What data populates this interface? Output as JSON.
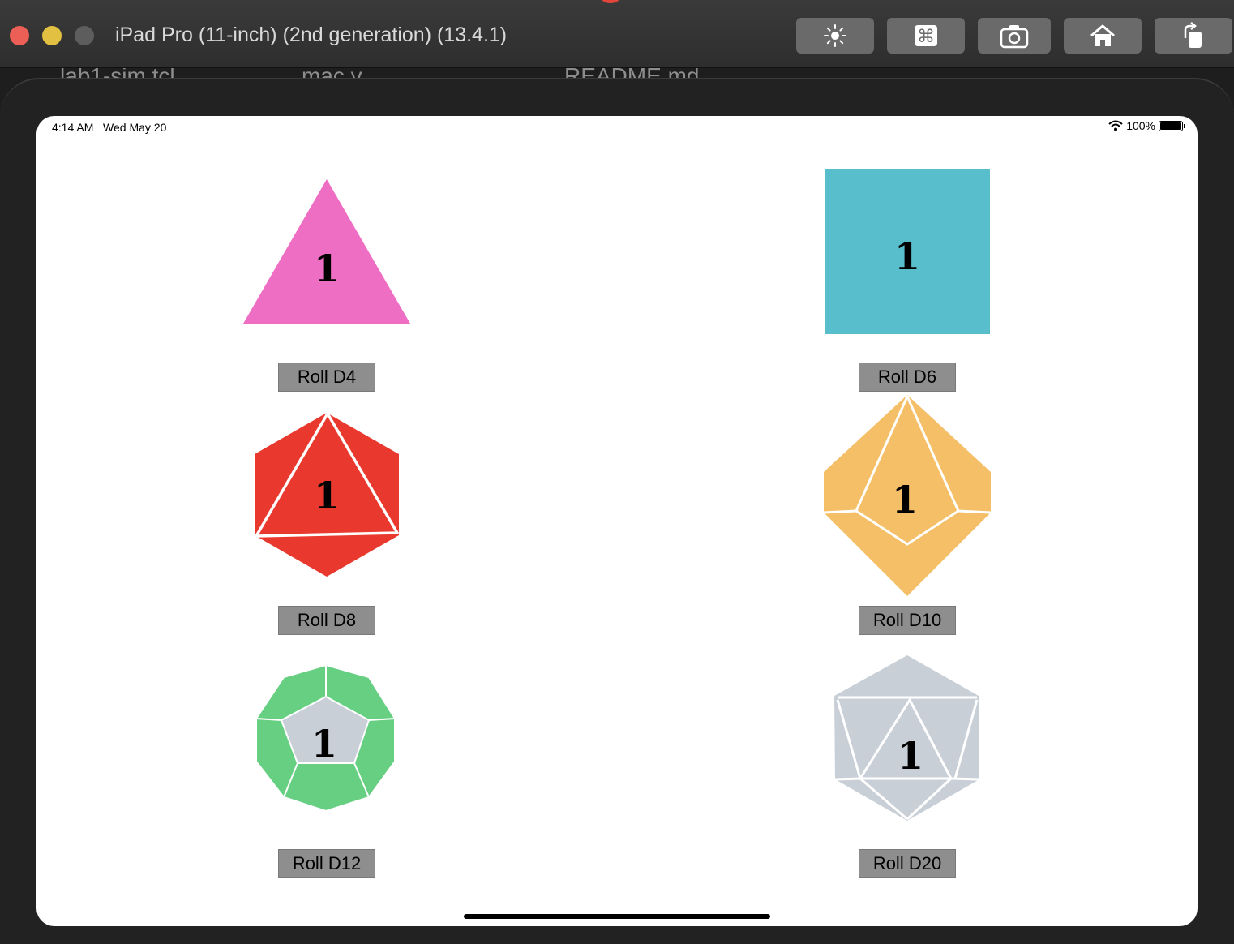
{
  "window": {
    "title": "iPad Pro (11-inch) (2nd generation) (13.4.1)",
    "toolbar": [
      {
        "icon": "brightness-icon"
      },
      {
        "icon": "command-key-icon",
        "label": "⌘"
      },
      {
        "icon": "screenshot-camera-icon"
      },
      {
        "icon": "home-icon"
      },
      {
        "icon": "rotate-icon"
      }
    ]
  },
  "background_editor": {
    "tabs": [
      "lab1-sim.tcl",
      "mac.v",
      "README.md"
    ]
  },
  "status_bar": {
    "time": "4:14 AM",
    "date": "Wed May 20",
    "battery": "100%"
  },
  "dice": [
    {
      "id": "d4",
      "value": "1",
      "color": "#EE6EC4",
      "button": "Roll D4"
    },
    {
      "id": "d6",
      "value": "1",
      "color": "#58BECB",
      "button": "Roll D6"
    },
    {
      "id": "d8",
      "value": "1",
      "color": "#E9392E",
      "button": "Roll D8"
    },
    {
      "id": "d10",
      "value": "1",
      "color": "#F4BF67",
      "button": "Roll D10"
    },
    {
      "id": "d12",
      "value": "1",
      "color": "#67CF82",
      "inner_color": "#C9CFD7",
      "button": "Roll D12"
    },
    {
      "id": "d20",
      "value": "1",
      "color": "#C9CFD7",
      "button": "Roll D20"
    }
  ]
}
